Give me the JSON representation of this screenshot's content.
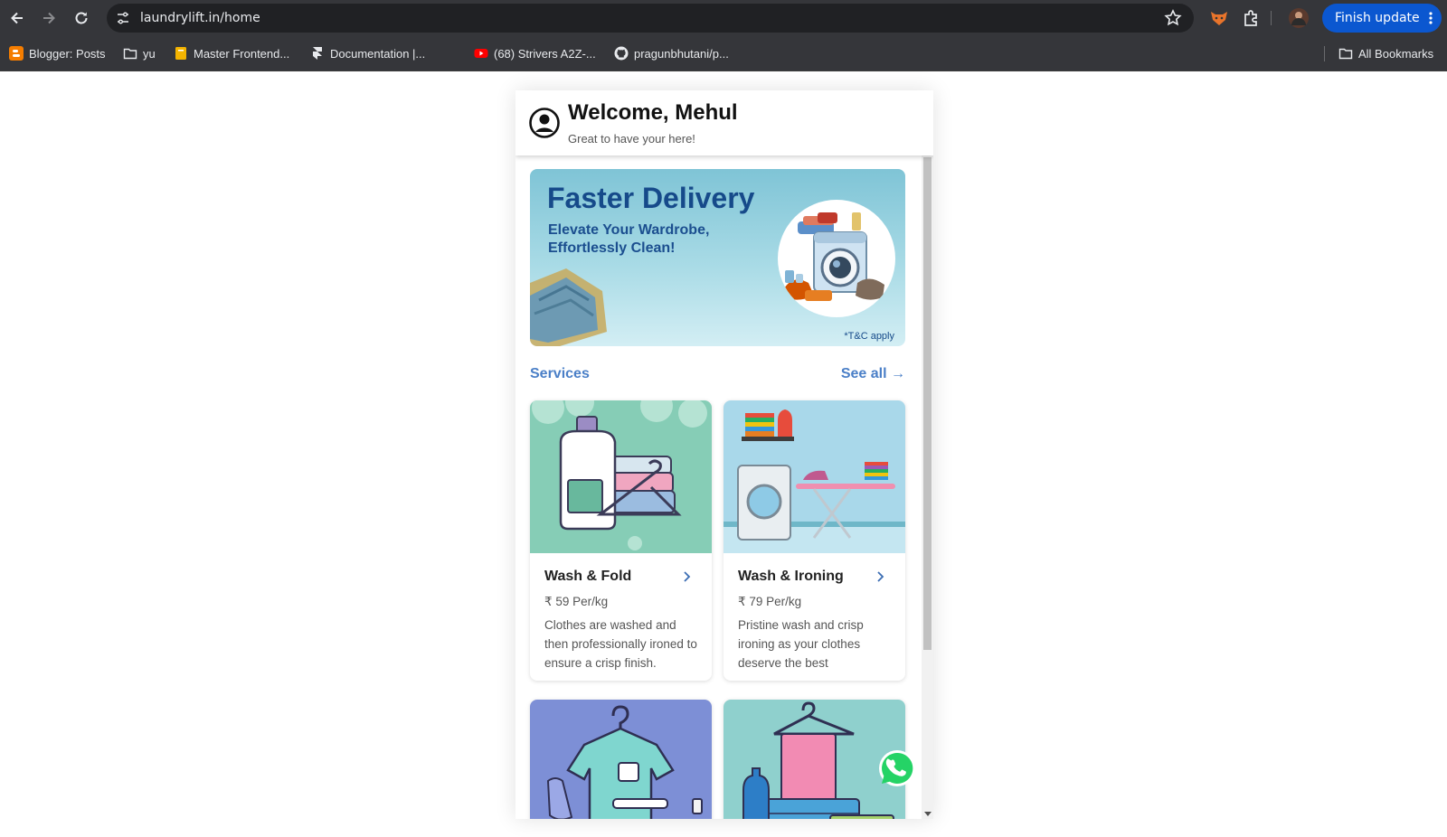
{
  "browser": {
    "url": "laundrylift.in/home",
    "finish_update_label": "Finish update",
    "bookmarks": [
      {
        "label": "Blogger: Posts",
        "icon": "blogger-icon"
      },
      {
        "label": "yu",
        "icon": "folder-icon"
      },
      {
        "label": "Master Frontend...",
        "icon": "notebook-icon"
      },
      {
        "label": "Documentation |...",
        "icon": "framer-icon"
      },
      {
        "label": "(68) Strivers A2Z-...",
        "icon": "youtube-icon"
      },
      {
        "label": "pragunbhutani/p...",
        "icon": "github-icon"
      }
    ],
    "all_bookmarks_label": "All Bookmarks"
  },
  "header": {
    "welcome": "Welcome, Mehul",
    "subtitle": "Great to have your here!"
  },
  "banner": {
    "title": "Faster Delivery",
    "subtitle": "Elevate Your Wardrobe, Effortlessly Clean!",
    "tc": "*T&C apply"
  },
  "services": {
    "label": "Services",
    "see_all": "See all →",
    "items": [
      {
        "title": "Wash & Fold",
        "price": "₹ 59 Per/kg",
        "description": "Clothes are washed and then professionally ironed to ensure a crisp finish."
      },
      {
        "title": "Wash & Ironing",
        "price": "₹ 79 Per/kg",
        "description": "Pristine wash and crisp ironing as your clothes deserve the best"
      }
    ]
  },
  "colors": {
    "accent": "#4a7fc7",
    "banner_title": "#164a8a",
    "chrome": "#35363a",
    "update_button": "#0b57d0"
  }
}
